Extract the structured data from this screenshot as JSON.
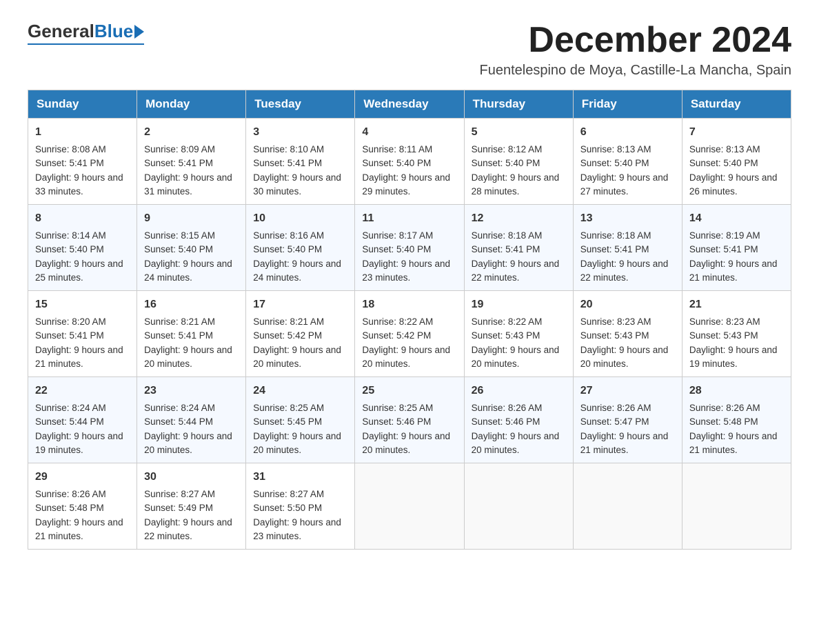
{
  "header": {
    "logo_general": "General",
    "logo_blue": "Blue",
    "month_title": "December 2024",
    "location": "Fuentelespino de Moya, Castille-La Mancha, Spain"
  },
  "weekdays": [
    "Sunday",
    "Monday",
    "Tuesday",
    "Wednesday",
    "Thursday",
    "Friday",
    "Saturday"
  ],
  "weeks": [
    [
      {
        "day": "1",
        "sunrise": "8:08 AM",
        "sunset": "5:41 PM",
        "daylight": "9 hours and 33 minutes."
      },
      {
        "day": "2",
        "sunrise": "8:09 AM",
        "sunset": "5:41 PM",
        "daylight": "9 hours and 31 minutes."
      },
      {
        "day": "3",
        "sunrise": "8:10 AM",
        "sunset": "5:41 PM",
        "daylight": "9 hours and 30 minutes."
      },
      {
        "day": "4",
        "sunrise": "8:11 AM",
        "sunset": "5:40 PM",
        "daylight": "9 hours and 29 minutes."
      },
      {
        "day": "5",
        "sunrise": "8:12 AM",
        "sunset": "5:40 PM",
        "daylight": "9 hours and 28 minutes."
      },
      {
        "day": "6",
        "sunrise": "8:13 AM",
        "sunset": "5:40 PM",
        "daylight": "9 hours and 27 minutes."
      },
      {
        "day": "7",
        "sunrise": "8:13 AM",
        "sunset": "5:40 PM",
        "daylight": "9 hours and 26 minutes."
      }
    ],
    [
      {
        "day": "8",
        "sunrise": "8:14 AM",
        "sunset": "5:40 PM",
        "daylight": "9 hours and 25 minutes."
      },
      {
        "day": "9",
        "sunrise": "8:15 AM",
        "sunset": "5:40 PM",
        "daylight": "9 hours and 24 minutes."
      },
      {
        "day": "10",
        "sunrise": "8:16 AM",
        "sunset": "5:40 PM",
        "daylight": "9 hours and 24 minutes."
      },
      {
        "day": "11",
        "sunrise": "8:17 AM",
        "sunset": "5:40 PM",
        "daylight": "9 hours and 23 minutes."
      },
      {
        "day": "12",
        "sunrise": "8:18 AM",
        "sunset": "5:41 PM",
        "daylight": "9 hours and 22 minutes."
      },
      {
        "day": "13",
        "sunrise": "8:18 AM",
        "sunset": "5:41 PM",
        "daylight": "9 hours and 22 minutes."
      },
      {
        "day": "14",
        "sunrise": "8:19 AM",
        "sunset": "5:41 PM",
        "daylight": "9 hours and 21 minutes."
      }
    ],
    [
      {
        "day": "15",
        "sunrise": "8:20 AM",
        "sunset": "5:41 PM",
        "daylight": "9 hours and 21 minutes."
      },
      {
        "day": "16",
        "sunrise": "8:21 AM",
        "sunset": "5:41 PM",
        "daylight": "9 hours and 20 minutes."
      },
      {
        "day": "17",
        "sunrise": "8:21 AM",
        "sunset": "5:42 PM",
        "daylight": "9 hours and 20 minutes."
      },
      {
        "day": "18",
        "sunrise": "8:22 AM",
        "sunset": "5:42 PM",
        "daylight": "9 hours and 20 minutes."
      },
      {
        "day": "19",
        "sunrise": "8:22 AM",
        "sunset": "5:43 PM",
        "daylight": "9 hours and 20 minutes."
      },
      {
        "day": "20",
        "sunrise": "8:23 AM",
        "sunset": "5:43 PM",
        "daylight": "9 hours and 20 minutes."
      },
      {
        "day": "21",
        "sunrise": "8:23 AM",
        "sunset": "5:43 PM",
        "daylight": "9 hours and 19 minutes."
      }
    ],
    [
      {
        "day": "22",
        "sunrise": "8:24 AM",
        "sunset": "5:44 PM",
        "daylight": "9 hours and 19 minutes."
      },
      {
        "day": "23",
        "sunrise": "8:24 AM",
        "sunset": "5:44 PM",
        "daylight": "9 hours and 20 minutes."
      },
      {
        "day": "24",
        "sunrise": "8:25 AM",
        "sunset": "5:45 PM",
        "daylight": "9 hours and 20 minutes."
      },
      {
        "day": "25",
        "sunrise": "8:25 AM",
        "sunset": "5:46 PM",
        "daylight": "9 hours and 20 minutes."
      },
      {
        "day": "26",
        "sunrise": "8:26 AM",
        "sunset": "5:46 PM",
        "daylight": "9 hours and 20 minutes."
      },
      {
        "day": "27",
        "sunrise": "8:26 AM",
        "sunset": "5:47 PM",
        "daylight": "9 hours and 21 minutes."
      },
      {
        "day": "28",
        "sunrise": "8:26 AM",
        "sunset": "5:48 PM",
        "daylight": "9 hours and 21 minutes."
      }
    ],
    [
      {
        "day": "29",
        "sunrise": "8:26 AM",
        "sunset": "5:48 PM",
        "daylight": "9 hours and 21 minutes."
      },
      {
        "day": "30",
        "sunrise": "8:27 AM",
        "sunset": "5:49 PM",
        "daylight": "9 hours and 22 minutes."
      },
      {
        "day": "31",
        "sunrise": "8:27 AM",
        "sunset": "5:50 PM",
        "daylight": "9 hours and 23 minutes."
      },
      null,
      null,
      null,
      null
    ]
  ]
}
